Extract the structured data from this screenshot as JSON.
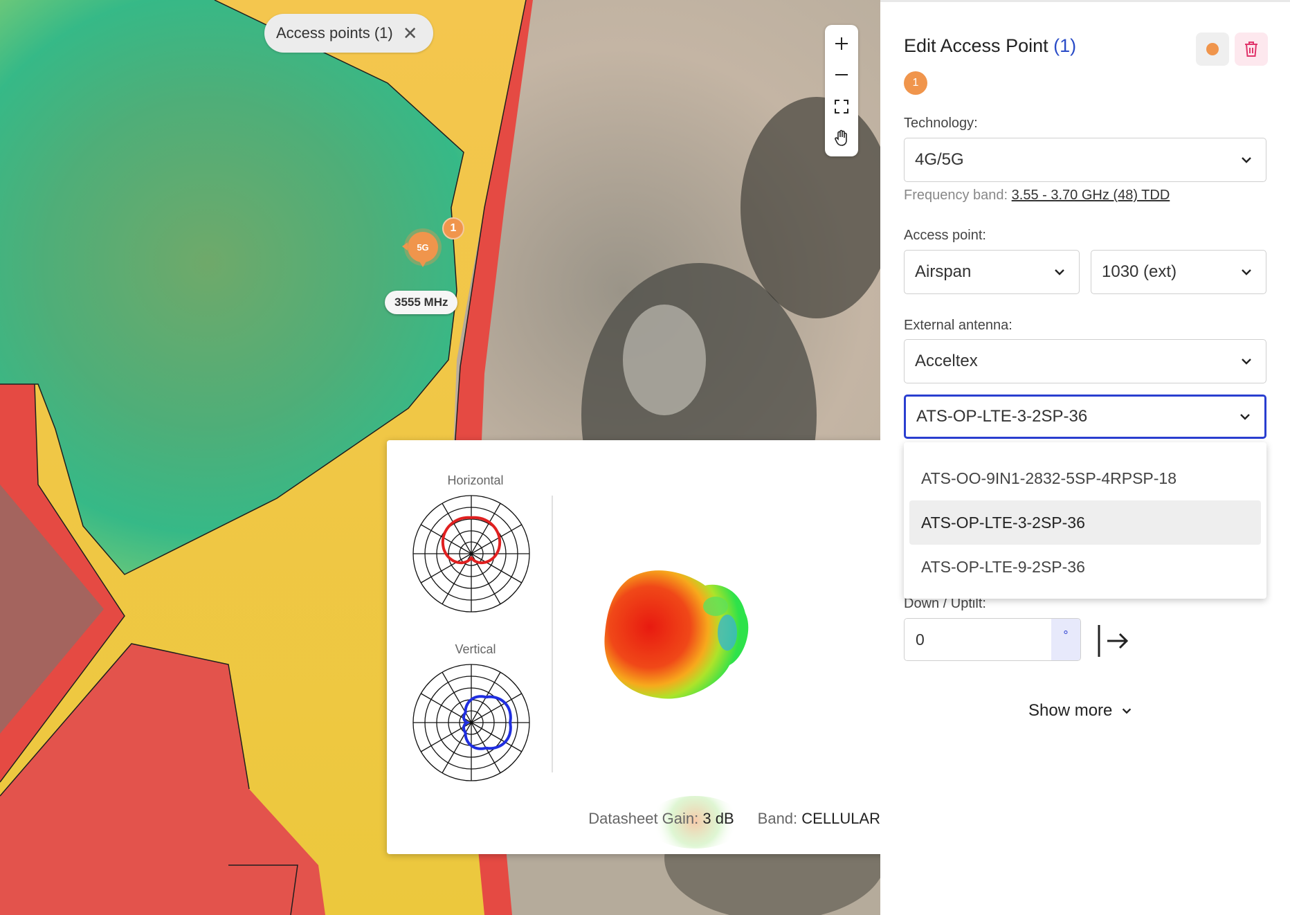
{
  "map": {
    "filter_chip": {
      "label": "Access points (1)",
      "close_icon": "close-icon"
    },
    "zoom_controls": [
      "zoom-in-icon",
      "zoom-out-icon",
      "fullscreen-icon",
      "pan-hand-icon"
    ],
    "ap_marker": {
      "label": "5G",
      "badge": "1",
      "frequency": "3555 MHz",
      "color": "#f0954c"
    }
  },
  "antenna_popup": {
    "horizontal_title": "Horizontal",
    "vertical_title": "Vertical",
    "gain_label": "Datasheet Gain:",
    "gain_value": "3 dB",
    "band_label": "Band:",
    "band_value": "CELLULAR",
    "horizontal_color": "#e02020",
    "vertical_color": "#1f2ee0"
  },
  "panel": {
    "title": "Edit Access Point",
    "title_count": "(1)",
    "badge": "1",
    "accent_color": "#2a4cc7",
    "technology": {
      "label": "Technology:",
      "value": "4G/5G"
    },
    "frequency": {
      "label": "Frequency band:",
      "value": "3.55 - 3.70 GHz (48) TDD"
    },
    "access_point": {
      "label": "Access point:",
      "vendor": "Airspan",
      "model": "1030 (ext)"
    },
    "external_antenna": {
      "label": "External antenna:",
      "vendor": "Acceltex",
      "model": "ATS-OP-LTE-3-2SP-36",
      "options": [
        "ATS-OO-9IN1-2832-5SP-4RPSP-18",
        "ATS-OP-LTE-3-2SP-36",
        "ATS-OP-LTE-9-2SP-36"
      ],
      "selected_index": 1
    },
    "tilt": {
      "label": "Down / Uptilt:",
      "value": "0",
      "unit": "°"
    },
    "show_more": "Show more"
  }
}
